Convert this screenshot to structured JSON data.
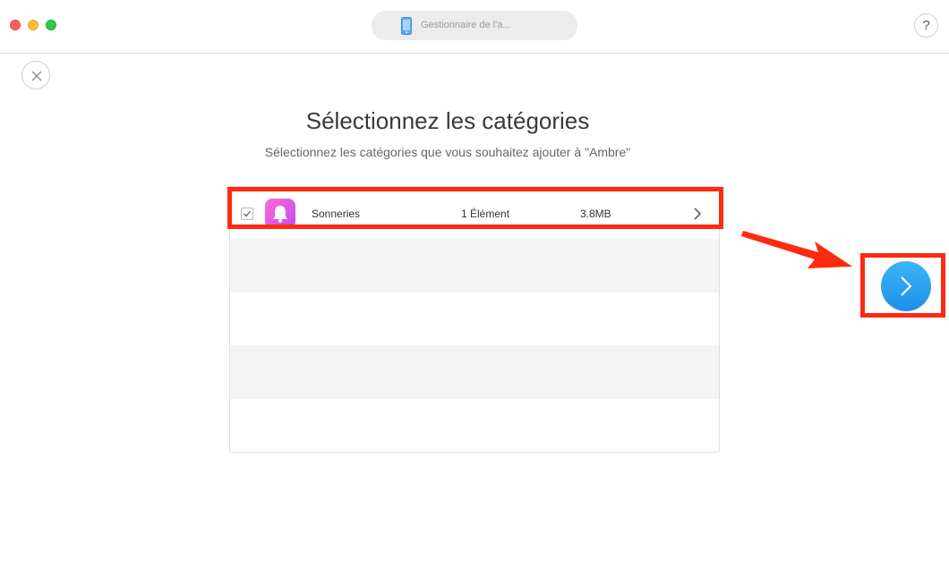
{
  "window": {
    "device_label": "Gestionnaire de l'a...",
    "help_label": "?"
  },
  "page": {
    "title": "Sélectionnez les catégories",
    "subtitle": "Sélectionnez les catégories que vous souhaitez ajouter à \"Ambre\""
  },
  "categories": [
    {
      "name": "Sonneries",
      "count": "1 Élément",
      "size": "3.8MB",
      "checked": true,
      "icon": "bell-icon"
    }
  ],
  "colors": {
    "accent": "#1e90e8",
    "highlight": "#ff2a0f",
    "app_icon_start": "#ff6ad5",
    "app_icon_end": "#c04bf0"
  },
  "icons": {
    "close": "close-icon",
    "device": "phone-icon",
    "next": "chevron-right-icon"
  }
}
